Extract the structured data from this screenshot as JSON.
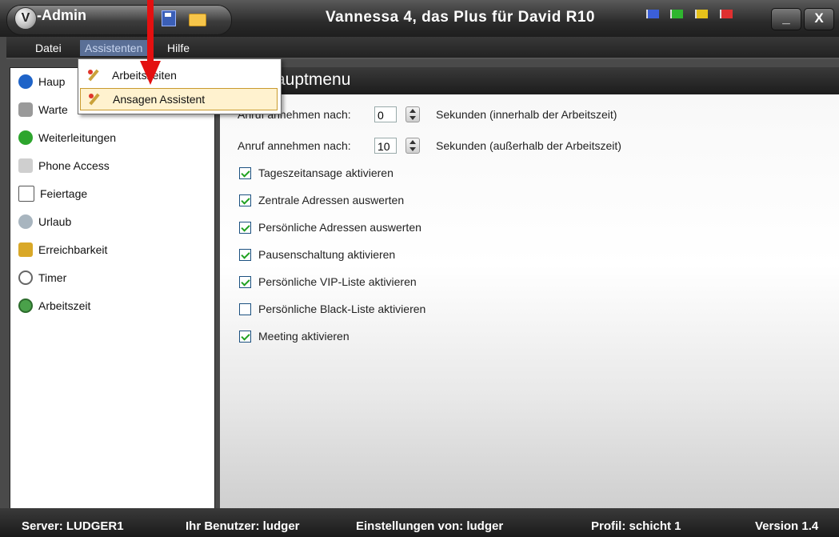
{
  "window": {
    "app_name": "-Admin",
    "logo_letter": "V",
    "title": "Vannessa 4, das Plus für David R10",
    "minimize": "_",
    "close": "X"
  },
  "menu": {
    "items": [
      "Datei",
      "Assistenten",
      "Hilfe"
    ],
    "active_index": 1
  },
  "dropdown": {
    "items": [
      "Arbeitszeiten",
      "Ansagen Assistent"
    ],
    "highlighted_index": 1
  },
  "sidebar": {
    "items": [
      {
        "label": "Haup",
        "icon": "arrow-circle-icon"
      },
      {
        "label": "Warte",
        "icon": "people-icon"
      },
      {
        "label": "Weiterleitungen",
        "icon": "forward-icon"
      },
      {
        "label": "Phone Access",
        "icon": "key-icon"
      },
      {
        "label": "Feiertage",
        "icon": "calendar-icon"
      },
      {
        "label": "Urlaub",
        "icon": "vacation-icon"
      },
      {
        "label": "Erreichbarkeit",
        "icon": "pen-icon"
      },
      {
        "label": "Timer",
        "icon": "stopwatch-icon"
      },
      {
        "label": "Arbeitszeit",
        "icon": "clock-icon"
      }
    ]
  },
  "main": {
    "title": "auptmenu",
    "fields": [
      {
        "label": "Anruf annehmen nach:",
        "value": "0",
        "suffix": "Sekunden (innerhalb der Arbeitszeit)"
      },
      {
        "label": "Anruf annehmen nach:",
        "value": "10",
        "suffix": "Sekunden (außerhalb der Arbeitszeit)"
      }
    ],
    "checkboxes": [
      {
        "label": "Tageszeitansage aktivieren",
        "checked": true
      },
      {
        "label": "Zentrale Adressen auswerten",
        "checked": true
      },
      {
        "label": "Persönliche Adressen auswerten",
        "checked": true
      },
      {
        "label": "Pausenschaltung aktivieren",
        "checked": true
      },
      {
        "label": "Persönliche VIP-Liste aktivieren",
        "checked": true
      },
      {
        "label": "Persönliche Black-Liste aktivieren",
        "checked": false
      },
      {
        "label": "Meeting aktivieren",
        "checked": true
      }
    ]
  },
  "status": {
    "server": "Server: LUDGER1",
    "user": "Ihr Benutzer: ludger",
    "settings": "Einstellungen von: ludger",
    "profile": "Profil: schicht 1",
    "version": "Version 1.4"
  },
  "colors": {
    "flags": [
      "#3b5fd9",
      "#2fb52f",
      "#e6c21a",
      "#e03030"
    ],
    "arrow": "#e41010"
  }
}
